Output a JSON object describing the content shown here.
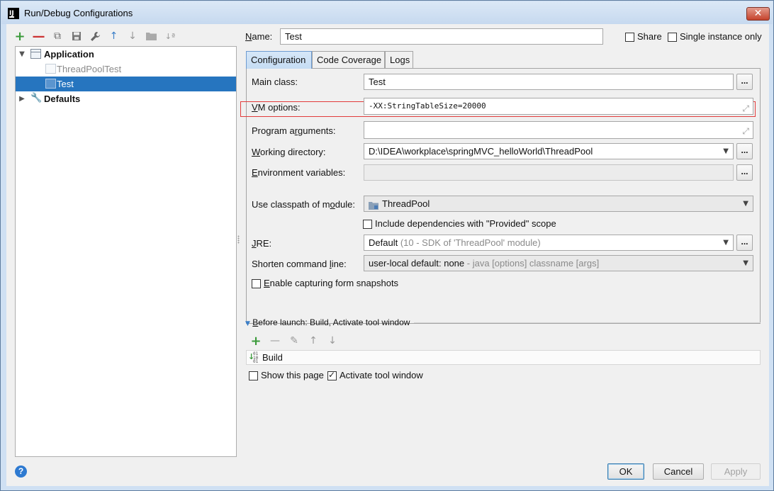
{
  "window": {
    "title": "Run/Debug Configurations",
    "app_icon_text": "IJ",
    "close_glyph": "✕"
  },
  "toolbar": {
    "add": "+",
    "remove": "—",
    "copy": "⧉",
    "save": "💾",
    "edit_defaults": "🔧",
    "move_up": "↑",
    "move_down": "↓",
    "folder": "■",
    "sort": "↓ª"
  },
  "tree": {
    "application": {
      "label": "Application",
      "expanded": true
    },
    "items": [
      {
        "label": "ThreadPoolTest",
        "selected": false
      },
      {
        "label": "Test",
        "selected": true
      }
    ],
    "defaults": {
      "label": "Defaults",
      "expanded": false
    }
  },
  "form": {
    "name_label_prefix": "N",
    "name_label_rest": "ame:",
    "name_value": "Test",
    "share_label": "Share",
    "share_checked": false,
    "single_instance_label": "Single instance only",
    "single_instance_checked": false
  },
  "tabs": [
    {
      "label": "Configuration",
      "active": true
    },
    {
      "label": "Code Coverage",
      "active": false
    },
    {
      "label": "Logs",
      "active": false
    }
  ],
  "config": {
    "main_class_label": "Main class:",
    "main_class_value": "Test",
    "vm_options_label_prefix": "V",
    "vm_options_label_rest": "M options:",
    "vm_options_value": "-XX:StringTableSize=20000",
    "program_args_label_a": "Program a",
    "program_args_label_b": "r",
    "program_args_label_c": "guments:",
    "program_args_value": "",
    "working_dir_label_prefix": "W",
    "working_dir_label_rest": "orking directory:",
    "working_dir_value": "D:\\IDEA\\workplace\\springMVC_helloWorld\\ThreadPool",
    "env_vars_label_prefix": "E",
    "env_vars_label_rest": "nvironment variables:",
    "env_vars_value": "",
    "classpath_label_a": "Use classpath of m",
    "classpath_label_b": "o",
    "classpath_label_c": "dule:",
    "classpath_value": "ThreadPool",
    "include_deps_label": "Include dependencies with \"Provided\" scope",
    "include_deps_checked": false,
    "jre_label_prefix": "J",
    "jre_label_rest": "RE:",
    "jre_value_main": "Default",
    "jre_value_detail": "(10 - SDK of 'ThreadPool' module)",
    "shorten_label_a": "Shorten command ",
    "shorten_label_b": "l",
    "shorten_label_c": "ine:",
    "shorten_value_main": "user-local default: none",
    "shorten_value_detail": " - java [options] classname [args]",
    "snapshots_label_prefix": "E",
    "snapshots_label_rest": "nable capturing form snapshots",
    "snapshots_checked": false,
    "browse": "..."
  },
  "before_launch": {
    "header_prefix": "B",
    "header_rest": "efore launch: Build, Activate tool window",
    "toolbar": {
      "add": "+",
      "remove": "—",
      "edit": "✎",
      "up": "↑",
      "down": "↓"
    },
    "items": [
      "Build"
    ],
    "build_icon_text": "01\n10\n01",
    "show_page_label": "Show this page",
    "show_page_checked": false,
    "activate_label": "Activate tool window",
    "activate_checked": true
  },
  "buttons": {
    "help": "?",
    "ok": "OK",
    "cancel": "Cancel",
    "apply": "Apply"
  },
  "colors": {
    "selection": "#2675bf",
    "highlight": "#e23b3b",
    "ok_border": "#3c7fb1"
  }
}
